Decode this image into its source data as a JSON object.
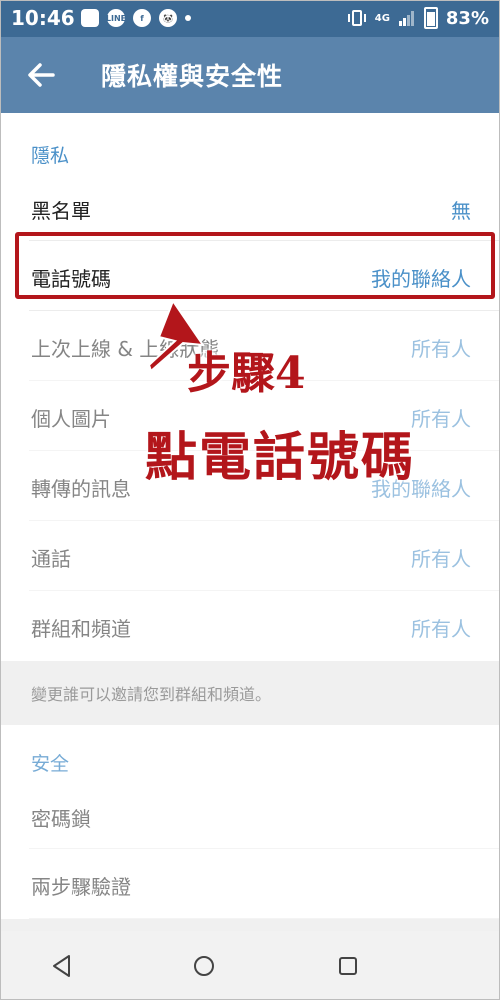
{
  "status_bar": {
    "time": "10:46",
    "network": "4G",
    "battery": "83%",
    "app_icons": [
      "image-icon",
      "line-icon",
      "facebook-icon",
      "foodpanda-icon",
      "dot-icon"
    ],
    "line_label": "LINE"
  },
  "app_bar": {
    "back_icon": "back-arrow-icon",
    "title": "隱私權與安全性"
  },
  "privacy": {
    "header": "隱私",
    "items": [
      {
        "label": "黑名單",
        "value": "無"
      },
      {
        "label": "電話號碼",
        "value": "我的聯絡人"
      },
      {
        "label": "上次上線 & 上線狀態",
        "value": "所有人"
      },
      {
        "label": "個人圖片",
        "value": "所有人"
      },
      {
        "label": "轉傳的訊息",
        "value": "我的聯絡人"
      },
      {
        "label": "通話",
        "value": "所有人"
      },
      {
        "label": "群組和頻道",
        "value": "所有人"
      }
    ],
    "info": "變更誰可以邀請您到群組和頻道。"
  },
  "security": {
    "header": "安全",
    "items": [
      {
        "label": "密碼鎖"
      },
      {
        "label": "兩步驟驗證"
      }
    ]
  },
  "annotation": {
    "line1": "步驟4",
    "line2": "點電話號碼",
    "color": "#b3161b"
  },
  "nav_bar": {
    "icons": [
      "back-triangle-icon",
      "home-circle-icon",
      "recents-square-icon"
    ]
  },
  "colors": {
    "status_bar": "#3d6a94",
    "app_bar": "#5b84ac",
    "accent": "#4a90c8"
  }
}
